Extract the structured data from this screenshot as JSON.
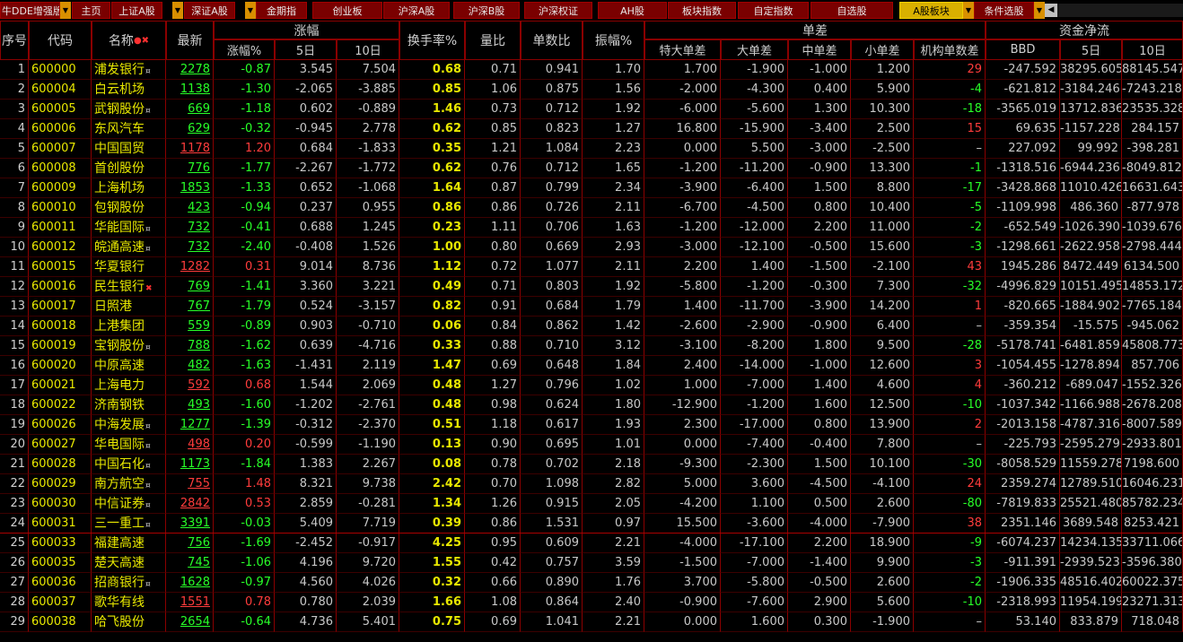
{
  "tabs": [
    {
      "label": "牛DDE增强版",
      "active": false
    },
    {
      "label": "主页",
      "active": false
    },
    {
      "label": "上证A股",
      "active": false
    },
    {
      "label": "深证A股",
      "active": false
    },
    {
      "label": "金期指",
      "active": false
    },
    {
      "label": "创业板",
      "active": false
    },
    {
      "label": "沪深A股",
      "active": false
    },
    {
      "label": "沪深B股",
      "active": false
    },
    {
      "label": "沪深权证",
      "active": false
    },
    {
      "label": "AH股",
      "active": false
    },
    {
      "label": "板块指数",
      "active": false
    },
    {
      "label": "自定指数",
      "active": false
    },
    {
      "label": "自选股",
      "active": false
    },
    {
      "label": "A股板块",
      "active": true
    },
    {
      "label": "条件选股",
      "active": false
    }
  ],
  "headers": {
    "seq": "序号",
    "code": "代码",
    "name": "名称",
    "name_marks": "●✖",
    "latest": "最新",
    "change_group": "涨幅",
    "chg_pct": "涨幅%",
    "d5": "5日",
    "d10": "10日",
    "turnover": "换手率%",
    "vol_ratio": "量比",
    "trade_ratio": "单数比",
    "amplitude": "振幅%",
    "diff_group": "单差",
    "xl": "特大单差",
    "large": "大单差",
    "mid": "中单差",
    "small": "小单差",
    "inst": "机构单数差",
    "flow_group": "资金净流",
    "bbd": "BBD",
    "f5": "5日",
    "f10": "10日"
  },
  "colors": {
    "up": "#ff3c3c",
    "down": "#28ff28",
    "accent": "#e8e800",
    "grid": "#8a0000",
    "tab": "#7a0000",
    "tab_active": "#d8b000"
  },
  "rows": [
    {
      "seq": "1",
      "code": "600000",
      "name": "浦发银行",
      "mark": "¤",
      "latest": "2278",
      "dir": "down",
      "chg": "-0.87",
      "d5": "3.545",
      "d10": "7.504",
      "turn": "0.68",
      "vr": "0.71",
      "tr": "0.941",
      "amp": "1.70",
      "xl": "1.700",
      "lg": "-1.900",
      "md": "-1.000",
      "sm": "1.200",
      "inst": "29",
      "idir": "up",
      "bbd": "-247.592",
      "f5": "38295.605",
      "f10": "88145.547"
    },
    {
      "seq": "2",
      "code": "600004",
      "name": "白云机场",
      "mark": "",
      "latest": "1138",
      "dir": "down",
      "chg": "-1.30",
      "d5": "-2.065",
      "d10": "-3.885",
      "turn": "0.85",
      "vr": "1.06",
      "tr": "0.875",
      "amp": "1.56",
      "xl": "-2.000",
      "lg": "-4.300",
      "md": "0.400",
      "sm": "5.900",
      "inst": "-4",
      "idir": "down",
      "bbd": "-621.812",
      "f5": "-3184.246",
      "f10": "-7243.218"
    },
    {
      "seq": "3",
      "code": "600005",
      "name": "武钢股份",
      "mark": "¤",
      "latest": "669",
      "dir": "down",
      "chg": "-1.18",
      "d5": "0.602",
      "d10": "-0.889",
      "turn": "1.46",
      "vr": "0.73",
      "tr": "0.712",
      "amp": "1.92",
      "xl": "-6.000",
      "lg": "-5.600",
      "md": "1.300",
      "sm": "10.300",
      "inst": "-18",
      "idir": "down",
      "bbd": "-3565.019",
      "f5": "13712.836",
      "f10": "23535.328"
    },
    {
      "seq": "4",
      "code": "600006",
      "name": "东风汽车",
      "mark": "",
      "latest": "629",
      "dir": "down",
      "chg": "-0.32",
      "d5": "-0.945",
      "d10": "2.778",
      "turn": "0.62",
      "vr": "0.85",
      "tr": "0.823",
      "amp": "1.27",
      "xl": "16.800",
      "lg": "-15.900",
      "md": "-3.400",
      "sm": "2.500",
      "inst": "15",
      "idir": "up",
      "bbd": "69.635",
      "f5": "-1157.228",
      "f10": "284.157"
    },
    {
      "seq": "5",
      "code": "600007",
      "name": "中国国贸",
      "mark": "",
      "latest": "1178",
      "dir": "up",
      "chg": "1.20",
      "d5": "0.684",
      "d10": "-1.833",
      "turn": "0.35",
      "vr": "1.21",
      "tr": "1.084",
      "amp": "2.23",
      "xl": "0.000",
      "lg": "5.500",
      "md": "-3.000",
      "sm": "-2.500",
      "inst": "–",
      "idir": "none",
      "bbd": "227.092",
      "f5": "99.992",
      "f10": "-398.281"
    },
    {
      "seq": "6",
      "code": "600008",
      "name": "首创股份",
      "mark": "",
      "latest": "776",
      "dir": "down",
      "chg": "-1.77",
      "d5": "-2.267",
      "d10": "-1.772",
      "turn": "0.62",
      "vr": "0.76",
      "tr": "0.712",
      "amp": "1.65",
      "xl": "-1.200",
      "lg": "-11.200",
      "md": "-0.900",
      "sm": "13.300",
      "inst": "-1",
      "idir": "down",
      "bbd": "-1318.516",
      "f5": "-6944.236",
      "f10": "-8049.812"
    },
    {
      "seq": "7",
      "code": "600009",
      "name": "上海机场",
      "mark": "",
      "latest": "1853",
      "dir": "down",
      "chg": "-1.33",
      "d5": "0.652",
      "d10": "-1.068",
      "turn": "1.64",
      "vr": "0.87",
      "tr": "0.799",
      "amp": "2.34",
      "xl": "-3.900",
      "lg": "-6.400",
      "md": "1.500",
      "sm": "8.800",
      "inst": "-17",
      "idir": "down",
      "bbd": "-3428.868",
      "f5": "11010.426",
      "f10": "16631.643"
    },
    {
      "seq": "8",
      "code": "600010",
      "name": "包钢股份",
      "mark": "",
      "latest": "423",
      "dir": "down",
      "chg": "-0.94",
      "d5": "0.237",
      "d10": "0.955",
      "turn": "0.86",
      "vr": "0.86",
      "tr": "0.726",
      "amp": "2.11",
      "xl": "-6.700",
      "lg": "-4.500",
      "md": "0.800",
      "sm": "10.400",
      "inst": "-5",
      "idir": "down",
      "bbd": "-1109.998",
      "f5": "486.360",
      "f10": "-877.978"
    },
    {
      "seq": "9",
      "code": "600011",
      "name": "华能国际",
      "mark": "¤",
      "latest": "732",
      "dir": "down",
      "chg": "-0.41",
      "d5": "0.688",
      "d10": "1.245",
      "turn": "0.23",
      "vr": "1.11",
      "tr": "0.706",
      "amp": "1.63",
      "xl": "-1.200",
      "lg": "-12.000",
      "md": "2.200",
      "sm": "11.000",
      "inst": "-2",
      "idir": "down",
      "bbd": "-652.549",
      "f5": "-1026.390",
      "f10": "-1039.676"
    },
    {
      "seq": "10",
      "code": "600012",
      "name": "皖通高速",
      "mark": "¤",
      "latest": "732",
      "dir": "down",
      "chg": "-2.40",
      "d5": "-0.408",
      "d10": "1.526",
      "turn": "1.00",
      "vr": "0.80",
      "tr": "0.669",
      "amp": "2.93",
      "xl": "-3.000",
      "lg": "-12.100",
      "md": "-0.500",
      "sm": "15.600",
      "inst": "-3",
      "idir": "down",
      "bbd": "-1298.661",
      "f5": "-2622.958",
      "f10": "-2798.444"
    },
    {
      "seq": "11",
      "code": "600015",
      "name": "华夏银行",
      "mark": "",
      "latest": "1282",
      "dir": "up",
      "chg": "0.31",
      "d5": "9.014",
      "d10": "8.736",
      "turn": "1.12",
      "vr": "0.72",
      "tr": "1.077",
      "amp": "2.11",
      "xl": "2.200",
      "lg": "1.400",
      "md": "-1.500",
      "sm": "-2.100",
      "inst": "43",
      "idir": "up",
      "bbd": "1945.286",
      "f5": "8472.449",
      "f10": "6134.500"
    },
    {
      "seq": "12",
      "code": "600016",
      "name": "民生银行",
      "mark": "✖",
      "latest": "769",
      "dir": "down",
      "chg": "-1.41",
      "d5": "3.360",
      "d10": "3.221",
      "turn": "0.49",
      "vr": "0.71",
      "tr": "0.803",
      "amp": "1.92",
      "xl": "-5.800",
      "lg": "-1.200",
      "md": "-0.300",
      "sm": "7.300",
      "inst": "-32",
      "idir": "down",
      "bbd": "-4996.829",
      "f5": "10151.495",
      "f10": "14853.172"
    },
    {
      "seq": "13",
      "code": "600017",
      "name": "日照港",
      "mark": "",
      "latest": "767",
      "dir": "down",
      "chg": "-1.79",
      "d5": "0.524",
      "d10": "-3.157",
      "turn": "0.82",
      "vr": "0.91",
      "tr": "0.684",
      "amp": "1.79",
      "xl": "1.400",
      "lg": "-11.700",
      "md": "-3.900",
      "sm": "14.200",
      "inst": "1",
      "idir": "up",
      "bbd": "-820.665",
      "f5": "-1884.902",
      "f10": "-7765.184"
    },
    {
      "seq": "14",
      "code": "600018",
      "name": "上港集团",
      "mark": "",
      "latest": "559",
      "dir": "down",
      "chg": "-0.89",
      "d5": "0.903",
      "d10": "-0.710",
      "turn": "0.06",
      "vr": "0.84",
      "tr": "0.862",
      "amp": "1.42",
      "xl": "-2.600",
      "lg": "-2.900",
      "md": "-0.900",
      "sm": "6.400",
      "inst": "–",
      "idir": "none",
      "bbd": "-359.354",
      "f5": "-15.575",
      "f10": "-945.062"
    },
    {
      "seq": "15",
      "code": "600019",
      "name": "宝钢股份",
      "mark": "¤",
      "latest": "788",
      "dir": "down",
      "chg": "-1.62",
      "d5": "0.639",
      "d10": "-4.716",
      "turn": "0.33",
      "vr": "0.88",
      "tr": "0.710",
      "amp": "3.12",
      "xl": "-3.100",
      "lg": "-8.200",
      "md": "1.800",
      "sm": "9.500",
      "inst": "-28",
      "idir": "down",
      "bbd": "-5178.741",
      "f5": "-6481.859",
      "f10": "45808.773"
    },
    {
      "seq": "16",
      "code": "600020",
      "name": "中原高速",
      "mark": "",
      "latest": "482",
      "dir": "down",
      "chg": "-1.63",
      "d5": "-1.431",
      "d10": "2.119",
      "turn": "1.47",
      "vr": "0.69",
      "tr": "0.648",
      "amp": "1.84",
      "xl": "2.400",
      "lg": "-14.000",
      "md": "-1.000",
      "sm": "12.600",
      "inst": "3",
      "idir": "up",
      "bbd": "-1054.455",
      "f5": "-1278.894",
      "f10": "857.706"
    },
    {
      "seq": "17",
      "code": "600021",
      "name": "上海电力",
      "mark": "",
      "latest": "592",
      "dir": "up",
      "chg": "0.68",
      "d5": "1.544",
      "d10": "2.069",
      "turn": "0.48",
      "vr": "1.27",
      "tr": "0.796",
      "amp": "1.02",
      "xl": "1.000",
      "lg": "-7.000",
      "md": "1.400",
      "sm": "4.600",
      "inst": "4",
      "idir": "up",
      "bbd": "-360.212",
      "f5": "-689.047",
      "f10": "-1552.326"
    },
    {
      "seq": "18",
      "code": "600022",
      "name": "济南钢铁",
      "mark": "",
      "latest": "493",
      "dir": "down",
      "chg": "-1.60",
      "d5": "-1.202",
      "d10": "-2.761",
      "turn": "0.48",
      "vr": "0.98",
      "tr": "0.624",
      "amp": "1.80",
      "xl": "-12.900",
      "lg": "-1.200",
      "md": "1.600",
      "sm": "12.500",
      "inst": "-10",
      "idir": "down",
      "bbd": "-1037.342",
      "f5": "-1166.988",
      "f10": "-2678.208"
    },
    {
      "seq": "19",
      "code": "600026",
      "name": "中海发展",
      "mark": "¤",
      "latest": "1277",
      "dir": "down",
      "chg": "-1.39",
      "d5": "-0.312",
      "d10": "-2.370",
      "turn": "0.51",
      "vr": "1.18",
      "tr": "0.617",
      "amp": "1.93",
      "xl": "2.300",
      "lg": "-17.000",
      "md": "0.800",
      "sm": "13.900",
      "inst": "2",
      "idir": "up",
      "bbd": "-2013.158",
      "f5": "-4787.316",
      "f10": "-8007.589"
    },
    {
      "seq": "20",
      "code": "600027",
      "name": "华电国际",
      "mark": "¤",
      "latest": "498",
      "dir": "up",
      "chg": "0.20",
      "d5": "-0.599",
      "d10": "-1.190",
      "turn": "0.13",
      "vr": "0.90",
      "tr": "0.695",
      "amp": "1.01",
      "xl": "0.000",
      "lg": "-7.400",
      "md": "-0.400",
      "sm": "7.800",
      "inst": "–",
      "idir": "none",
      "bbd": "-225.793",
      "f5": "-2595.279",
      "f10": "-2933.801"
    },
    {
      "seq": "21",
      "code": "600028",
      "name": "中国石化",
      "mark": "¤",
      "latest": "1173",
      "dir": "down",
      "chg": "-1.84",
      "d5": "1.383",
      "d10": "2.267",
      "turn": "0.08",
      "vr": "0.78",
      "tr": "0.702",
      "amp": "2.18",
      "xl": "-9.300",
      "lg": "-2.300",
      "md": "1.500",
      "sm": "10.100",
      "inst": "-30",
      "idir": "down",
      "bbd": "-8058.529",
      "f5": "11559.278",
      "f10": "7198.600"
    },
    {
      "seq": "22",
      "code": "600029",
      "name": "南方航空",
      "mark": "¤",
      "latest": "755",
      "dir": "up",
      "chg": "1.48",
      "d5": "8.321",
      "d10": "9.738",
      "turn": "2.42",
      "vr": "0.70",
      "tr": "1.098",
      "amp": "2.82",
      "xl": "5.000",
      "lg": "3.600",
      "md": "-4.500",
      "sm": "-4.100",
      "inst": "24",
      "idir": "up",
      "bbd": "2359.274",
      "f5": "12789.510",
      "f10": "16046.231"
    },
    {
      "seq": "23",
      "code": "600030",
      "name": "中信证券",
      "mark": "¤",
      "latest": "2842",
      "dir": "up",
      "chg": "0.53",
      "d5": "2.859",
      "d10": "-0.281",
      "turn": "1.34",
      "vr": "1.26",
      "tr": "0.915",
      "amp": "2.05",
      "xl": "-4.200",
      "lg": "1.100",
      "md": "0.500",
      "sm": "2.600",
      "inst": "-80",
      "idir": "down",
      "bbd": "-7819.833",
      "f5": "25521.480",
      "f10": "85782.234"
    },
    {
      "seq": "24",
      "code": "600031",
      "name": "三一重工",
      "mark": "¤",
      "latest": "3391",
      "dir": "down",
      "chg": "-0.03",
      "d5": "5.409",
      "d10": "7.719",
      "turn": "0.39",
      "vr": "0.86",
      "tr": "1.531",
      "amp": "0.97",
      "xl": "15.500",
      "lg": "-3.600",
      "md": "-4.000",
      "sm": "-7.900",
      "inst": "38",
      "idir": "up",
      "bbd": "2351.146",
      "f5": "3689.548",
      "f10": "8253.421"
    },
    {
      "seq": "25",
      "code": "600033",
      "name": "福建高速",
      "mark": "",
      "latest": "756",
      "dir": "down",
      "chg": "-1.69",
      "d5": "-2.452",
      "d10": "-0.917",
      "turn": "4.25",
      "vr": "0.95",
      "tr": "0.609",
      "amp": "2.21",
      "xl": "-4.000",
      "lg": "-17.100",
      "md": "2.200",
      "sm": "18.900",
      "inst": "-9",
      "idir": "down",
      "bbd": "-6074.237",
      "f5": "14234.135",
      "f10": "33711.066"
    },
    {
      "seq": "26",
      "code": "600035",
      "name": "楚天高速",
      "mark": "",
      "latest": "745",
      "dir": "down",
      "chg": "-1.06",
      "d5": "4.196",
      "d10": "9.720",
      "turn": "1.55",
      "vr": "0.42",
      "tr": "0.757",
      "amp": "3.59",
      "xl": "-1.500",
      "lg": "-7.000",
      "md": "-1.400",
      "sm": "9.900",
      "inst": "-3",
      "idir": "down",
      "bbd": "-911.391",
      "f5": "-2939.523",
      "f10": "-3596.380"
    },
    {
      "seq": "27",
      "code": "600036",
      "name": "招商银行",
      "mark": "¤",
      "latest": "1628",
      "dir": "down",
      "chg": "-0.97",
      "d5": "4.560",
      "d10": "4.026",
      "turn": "0.32",
      "vr": "0.66",
      "tr": "0.890",
      "amp": "1.76",
      "xl": "3.700",
      "lg": "-5.800",
      "md": "-0.500",
      "sm": "2.600",
      "inst": "-2",
      "idir": "down",
      "bbd": "-1906.335",
      "f5": "48516.402",
      "f10": "60022.375"
    },
    {
      "seq": "28",
      "code": "600037",
      "name": "歌华有线",
      "mark": "",
      "latest": "1551",
      "dir": "up",
      "chg": "0.78",
      "d5": "0.780",
      "d10": "2.039",
      "turn": "1.66",
      "vr": "1.08",
      "tr": "0.864",
      "amp": "2.40",
      "xl": "-0.900",
      "lg": "-7.600",
      "md": "2.900",
      "sm": "5.600",
      "inst": "-10",
      "idir": "down",
      "bbd": "-2318.993",
      "f5": "11954.199",
      "f10": "23271.313"
    },
    {
      "seq": "29",
      "code": "600038",
      "name": "哈飞股份",
      "mark": "",
      "latest": "2654",
      "dir": "down",
      "chg": "-0.64",
      "d5": "4.736",
      "d10": "5.401",
      "turn": "0.75",
      "vr": "0.69",
      "tr": "1.041",
      "amp": "2.21",
      "xl": "0.000",
      "lg": "1.600",
      "md": "0.300",
      "sm": "-1.900",
      "inst": "–",
      "idir": "none",
      "bbd": "53.140",
      "f5": "833.879",
      "f10": "718.048"
    }
  ]
}
